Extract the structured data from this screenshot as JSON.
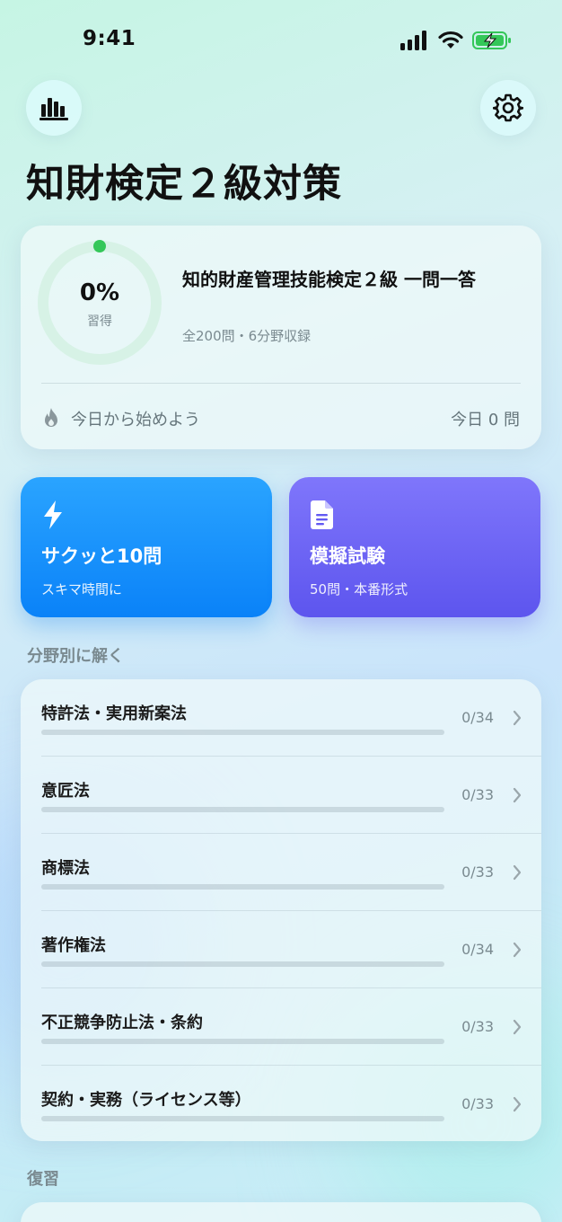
{
  "status_bar": {
    "time": "9:41"
  },
  "header": {
    "stats_icon": "bar-chart-icon",
    "settings_icon": "gear-icon",
    "title": "知財検定２級対策"
  },
  "progress_card": {
    "percent_text": "0%",
    "percent_label": "習得",
    "progress": 0,
    "title": "知的財産管理技能検定２級 一問一答",
    "subtitle": "全200問・6分野収録",
    "streak_text": "今日から始めよう",
    "today_text": "今日 0 問",
    "colors": {
      "ring_track": "#d7f2e6",
      "ring_dot": "#34c759"
    }
  },
  "actions": {
    "quick": {
      "title": "サクッと10問",
      "subtitle": "スキマ時間に",
      "icon": "bolt-icon",
      "color": "#0a82f8"
    },
    "exam": {
      "title": "模擬試験",
      "subtitle": "50問・本番形式",
      "icon": "document-icon",
      "color": "#6259f2"
    }
  },
  "topics": {
    "label": "分野別に解く",
    "items": [
      {
        "name": "特許法・実用新案法",
        "count": "0/34",
        "progress": 0
      },
      {
        "name": "意匠法",
        "count": "0/33",
        "progress": 0
      },
      {
        "name": "商標法",
        "count": "0/33",
        "progress": 0
      },
      {
        "name": "著作権法",
        "count": "0/34",
        "progress": 0
      },
      {
        "name": "不正競争防止法・条約",
        "count": "0/33",
        "progress": 0
      },
      {
        "name": "契約・実務（ライセンス等）",
        "count": "0/33",
        "progress": 0
      }
    ]
  },
  "review": {
    "label": "復習"
  }
}
